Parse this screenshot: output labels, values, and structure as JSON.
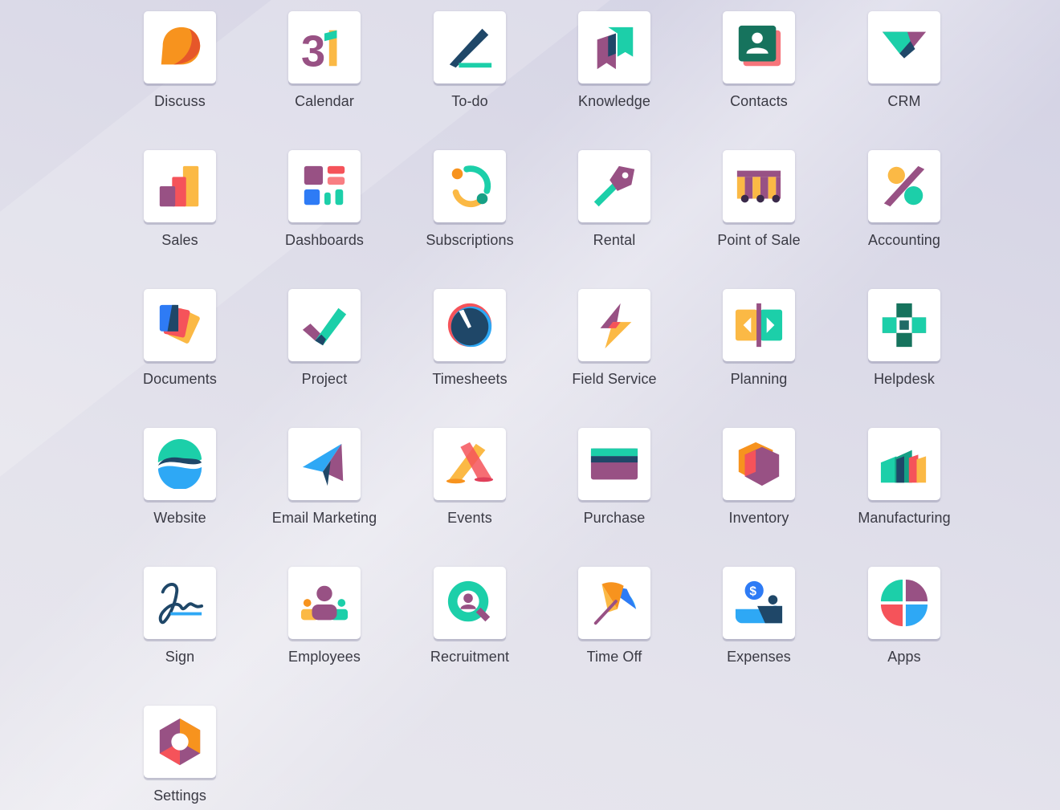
{
  "apps": [
    {
      "label": "Discuss",
      "icon": "discuss-icon"
    },
    {
      "label": "Calendar",
      "icon": "calendar-icon"
    },
    {
      "label": "To-do",
      "icon": "todo-icon"
    },
    {
      "label": "Knowledge",
      "icon": "knowledge-icon"
    },
    {
      "label": "Contacts",
      "icon": "contacts-icon"
    },
    {
      "label": "CRM",
      "icon": "crm-icon"
    },
    {
      "label": "Sales",
      "icon": "sales-icon"
    },
    {
      "label": "Dashboards",
      "icon": "dashboards-icon"
    },
    {
      "label": "Subscriptions",
      "icon": "subscriptions-icon"
    },
    {
      "label": "Rental",
      "icon": "rental-icon"
    },
    {
      "label": "Point of Sale",
      "icon": "point-of-sale-icon"
    },
    {
      "label": "Accounting",
      "icon": "accounting-icon"
    },
    {
      "label": "Documents",
      "icon": "documents-icon"
    },
    {
      "label": "Project",
      "icon": "project-icon"
    },
    {
      "label": "Timesheets",
      "icon": "timesheets-icon"
    },
    {
      "label": "Field Service",
      "icon": "field-service-icon"
    },
    {
      "label": "Planning",
      "icon": "planning-icon"
    },
    {
      "label": "Helpdesk",
      "icon": "helpdesk-icon"
    },
    {
      "label": "Website",
      "icon": "website-icon"
    },
    {
      "label": "Email Marketing",
      "icon": "email-marketing-icon"
    },
    {
      "label": "Events",
      "icon": "events-icon"
    },
    {
      "label": "Purchase",
      "icon": "purchase-icon"
    },
    {
      "label": "Inventory",
      "icon": "inventory-icon"
    },
    {
      "label": "Manufacturing",
      "icon": "manufacturing-icon"
    },
    {
      "label": "Sign",
      "icon": "sign-icon"
    },
    {
      "label": "Employees",
      "icon": "employees-icon"
    },
    {
      "label": "Recruitment",
      "icon": "recruitment-icon"
    },
    {
      "label": "Time Off",
      "icon": "time-off-icon"
    },
    {
      "label": "Expenses",
      "icon": "expenses-icon"
    },
    {
      "label": "Apps",
      "icon": "apps-icon"
    },
    {
      "label": "Settings",
      "icon": "settings-icon"
    }
  ],
  "colors": {
    "label_text": "#3a3a44",
    "tile_bg": "#ffffff",
    "teal": "#1ccfa9",
    "purple": "#985184",
    "orange": "#fa7e1e",
    "yellow": "#fbb945",
    "blue": "#2ea8f5",
    "navy": "#1f4768",
    "red": "#f5535a"
  }
}
